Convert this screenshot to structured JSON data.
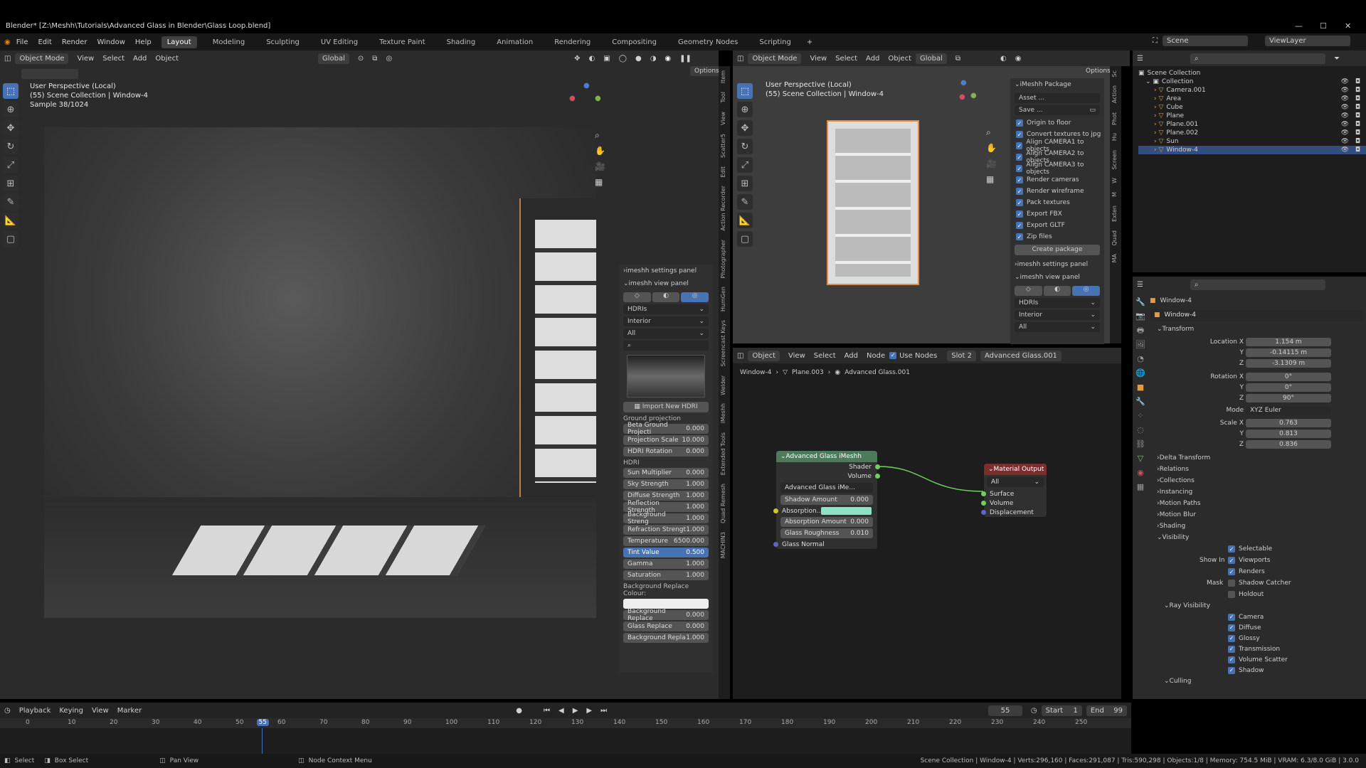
{
  "title": "Blender* [Z:\\Meshh\\Tutorials\\Advanced Glass in Blender\\Glass Loop.blend]",
  "menu": [
    "File",
    "Edit",
    "Render",
    "Window",
    "Help"
  ],
  "workspaces": [
    "Layout",
    "Modeling",
    "Sculpting",
    "UV Editing",
    "Texture Paint",
    "Shading",
    "Animation",
    "Rendering",
    "Compositing",
    "Geometry Nodes",
    "Scripting"
  ],
  "scene": "Scene",
  "viewlayer": "ViewLayer",
  "left_vp": {
    "mode": "Object Mode",
    "menu": [
      "View",
      "Select",
      "Add",
      "Object"
    ],
    "orient": "Global",
    "options": "Options",
    "ov1": "User Perspective (Local)",
    "ov2": "(55) Scene Collection | Window-4",
    "ov3": "Sample 38/1024"
  },
  "npanel": {
    "settings": "imeshh settings panel",
    "view": "imeshh view panel",
    "d1": "HDRIs",
    "d2": "Interior",
    "d3": "All",
    "import": "Import New HDRI",
    "ground": "Ground projection",
    "gfields": [
      [
        "Beta Ground Projecti",
        "0.000"
      ],
      [
        "Projection Scale",
        "10.000"
      ],
      [
        "HDRI Rotation",
        "0.000"
      ]
    ],
    "hdri": "HDRI",
    "hfields": [
      [
        "Sun Multiplier",
        "0.000"
      ],
      [
        "Sky Strength",
        "1.000"
      ],
      [
        "Diffuse Strength",
        "1.000"
      ],
      [
        "Reflection Strength",
        "1.000"
      ],
      [
        "Background Streng",
        "1.000"
      ],
      [
        "Refraction Strengt",
        "1.000"
      ],
      [
        "Temperature",
        "6500.000"
      ],
      [
        "Tint Value",
        "0.500"
      ],
      [
        "Gamma",
        "1.000"
      ],
      [
        "Saturation",
        "1.000"
      ]
    ],
    "bgrep": "Background Replace Colour:",
    "bfields": [
      [
        "Background Replace",
        "0.000"
      ],
      [
        "Glass Replace",
        "0.000"
      ],
      [
        "Background Repla",
        "1.000"
      ]
    ]
  },
  "vtabs_l": [
    "Item",
    "Tool",
    "View",
    "Scatter5",
    "Edit",
    "Action Recorder",
    "Photographer",
    "HumGen",
    "Screencast Keys",
    "Welder",
    "iMeshh",
    "Extended Tools",
    "Quad Remesh",
    "MACHIN3"
  ],
  "right_vp": {
    "mode": "Object Mode",
    "menu": [
      "View",
      "Select",
      "Add",
      "Object"
    ],
    "orient": "Global",
    "options": "Options",
    "ov1": "User Perspective (Local)",
    "ov2": "(55) Scene Collection | Window-4"
  },
  "pkg": {
    "title": "iMeshh Package",
    "asset": "Asset ...",
    "save": "Save ...",
    "checks": [
      "Origin to floor",
      "Convert textures to jpg",
      "Align CAMERA1 to objects",
      "Align CAMERA2 to objects",
      "Align CAMERA3 to objects",
      "Render cameras",
      "Render wireframe",
      "Pack textures",
      "Export FBX",
      "Export GLTF",
      "Zip files"
    ],
    "create": "Create package",
    "settings": "imeshh settings panel",
    "view": "imeshh view panel",
    "d1": "HDRIs",
    "d2": "Interior",
    "d3": "All"
  },
  "vtabs_r": [
    "Sc",
    "Action",
    "Phot",
    "Hu",
    "Screen",
    "W",
    "M",
    "Exten",
    "Quad",
    "MA"
  ],
  "node_ed": {
    "obj": "Object",
    "menu": [
      "View",
      "Select",
      "Add",
      "Node"
    ],
    "use_nodes": "Use Nodes",
    "slot": "Slot 2",
    "mat": "Advanced Glass.001",
    "crumbs": [
      "Window-4",
      "Plane.003",
      "Advanced Glass.001"
    ]
  },
  "glass_node": {
    "title": "Advanced Glass iMeshh",
    "outs": [
      "Shader",
      "Volume"
    ],
    "group": "Advanced Glass iMe...",
    "ins": [
      [
        "Shadow Amount",
        "0.000"
      ],
      [
        "Absorption...",
        ""
      ],
      [
        "Absorption Amount",
        "0.000"
      ],
      [
        "Glass Roughness",
        "0.010"
      ],
      [
        "Glass Normal",
        ""
      ]
    ]
  },
  "mat_out": {
    "title": "Material Output",
    "target": "All",
    "ins": [
      "Surface",
      "Volume",
      "Displacement"
    ]
  },
  "outliner": {
    "root": "Scene Collection",
    "coll": "Collection",
    "items": [
      "Camera.001",
      "Area",
      "Cube",
      "Plane",
      "Plane.001",
      "Plane.002",
      "Sun",
      "Window-4"
    ]
  },
  "props": {
    "obj": "Window-4",
    "name": "Window-4",
    "transform": "Transform",
    "loc": [
      [
        "Location X",
        "1.154 m"
      ],
      [
        "Y",
        "-0.14115 m"
      ],
      [
        "Z",
        "-3.1309 m"
      ]
    ],
    "rot": [
      [
        "Rotation X",
        "0°"
      ],
      [
        "Y",
        "0°"
      ],
      [
        "Z",
        "90°"
      ]
    ],
    "mode_l": "Mode",
    "mode": "XYZ Euler",
    "scale": [
      [
        "Scale X",
        "0.763"
      ],
      [
        "Y",
        "0.813"
      ],
      [
        "Z",
        "0.836"
      ]
    ],
    "secs": [
      "Delta Transform",
      "Relations",
      "Collections",
      "Instancing",
      "Motion Paths",
      "Motion Blur",
      "Shading"
    ],
    "vis": "Visibility",
    "selectable": "Selectable",
    "showin": "Show In",
    "viewports": "Viewports",
    "renders": "Renders",
    "mask": "Mask",
    "shadowcatcher": "Shadow Catcher",
    "holdout": "Holdout",
    "rayvis": "Ray Visibility",
    "rays": [
      "Camera",
      "Diffuse",
      "Glossy",
      "Transmission",
      "Volume Scatter",
      "Shadow"
    ],
    "culling": "Culling"
  },
  "timeline": {
    "menu": [
      "Playback",
      "Keying",
      "View",
      "Marker"
    ],
    "frame": "55",
    "start_l": "Start",
    "start": "1",
    "end_l": "End",
    "end": "99",
    "ticks": [
      "0",
      "10",
      "20",
      "30",
      "40",
      "50",
      "55",
      "60",
      "70",
      "80",
      "90",
      "100",
      "110",
      "120",
      "130",
      "140",
      "150",
      "160",
      "170",
      "180",
      "190",
      "200",
      "210",
      "220",
      "230",
      "240",
      "250"
    ]
  },
  "status": {
    "select": "Select",
    "box": "Box Select",
    "pan": "Pan View",
    "ctx": "Node Context Menu",
    "info": "Scene Collection | Window-4 | Verts:296,160 | Faces:291,087 | Tris:590,298 | Objects:1/8 | Memory: 754.5 MiB | VRAM: 6.3/8.0 GiB | 3.0.0"
  }
}
